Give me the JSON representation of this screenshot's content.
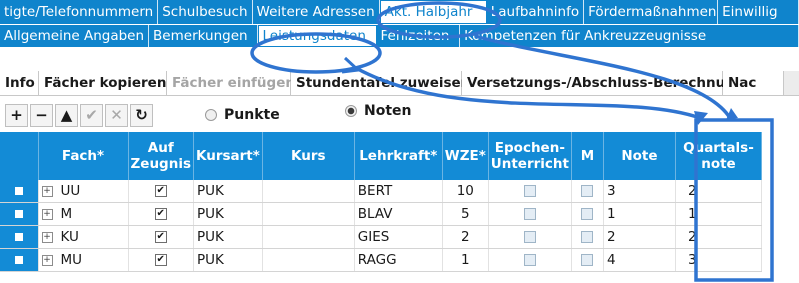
{
  "tabs_row1": [
    "tigte/Telefonnummern",
    "Schulbesuch",
    "Weitere Adressen",
    "Akt. Halbjahr",
    "Laufbahninfo",
    "Fördermaßnahmen",
    "Einwillig"
  ],
  "tabs_row2": [
    "Allgemeine Angaben",
    "Bemerkungen",
    "Leistungsdaten",
    "Fehlzeiten",
    "Kompetenzen für Ankreuzzeugnisse"
  ],
  "toolbar": [
    "Info",
    "Fächer kopieren",
    "Fächer einfügen",
    "Stundentafel zuweisen",
    "Versetzungs-/Abschluss-Berechnung",
    "Nac"
  ],
  "actions": [
    "+",
    "−",
    "▲",
    "✔",
    "✕",
    "↻"
  ],
  "radio": {
    "points": "Punkte",
    "grades": "Noten"
  },
  "columns": [
    "",
    "Fach*",
    "Auf Zeugnis",
    "Kursart*",
    "Kurs",
    "Lehrkraft*",
    "WZE*",
    "Epochen-Unterricht",
    "M",
    "Note",
    "Quartals-note"
  ],
  "rows": [
    {
      "fach": "UU",
      "auf_zeugnis": true,
      "kursart": "PUK",
      "kurs": "",
      "lehrkraft": "BERT",
      "wze": "10",
      "epochen": false,
      "m": false,
      "note": "3",
      "quartal": "2"
    },
    {
      "fach": "M",
      "auf_zeugnis": true,
      "kursart": "PUK",
      "kurs": "",
      "lehrkraft": "BLAV",
      "wze": "5",
      "epochen": false,
      "m": false,
      "note": "1",
      "quartal": "1"
    },
    {
      "fach": "KU",
      "auf_zeugnis": true,
      "kursart": "PUK",
      "kurs": "",
      "lehrkraft": "GIES",
      "wze": "2",
      "epochen": false,
      "m": false,
      "note": "2",
      "quartal": "2"
    },
    {
      "fach": "MU",
      "auf_zeugnis": true,
      "kursart": "PUK",
      "kurs": "",
      "lehrkraft": "RAGG",
      "wze": "1",
      "epochen": false,
      "m": false,
      "note": "4",
      "quartal": "3"
    }
  ],
  "colors": {
    "tab_bg": "#0f84cc",
    "header_bg": "#138bd6",
    "annotation": "#2f74d0"
  }
}
